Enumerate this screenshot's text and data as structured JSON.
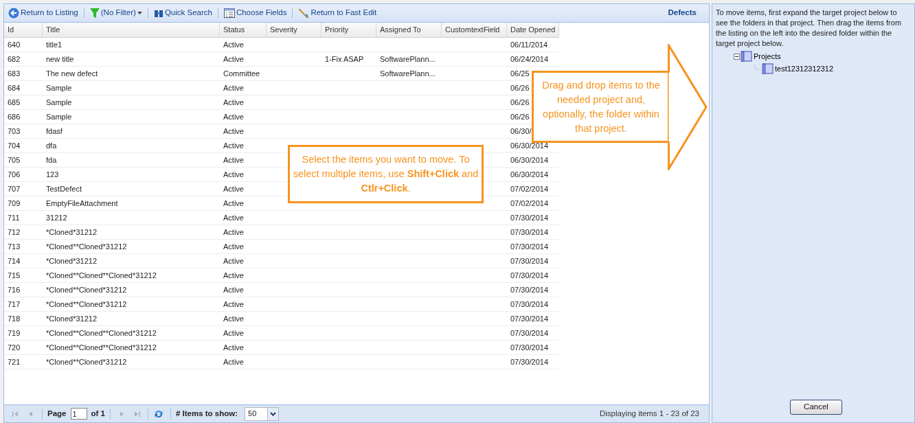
{
  "toolbar": {
    "buttons": [
      {
        "kind": "back",
        "label": "Return to Listing"
      },
      {
        "kind": "filter",
        "label": "(No Filter)"
      },
      {
        "kind": "search",
        "label": "Quick Search"
      },
      {
        "kind": "fields",
        "label": "Choose Fields"
      },
      {
        "kind": "edit",
        "label": "Return to Fast Edit"
      }
    ],
    "title": "Defects"
  },
  "table": {
    "columns": [
      "Id",
      "Title",
      "Status",
      "Severity",
      "Priority",
      "Assigned To",
      "CustomtextField",
      "Date Opened"
    ],
    "rows": [
      {
        "id": "640",
        "title": "title1",
        "status": "Active",
        "date_opened": "06/11/2014"
      },
      {
        "id": "682",
        "title": "new title",
        "status": "Active",
        "priority": "1-Fix ASAP",
        "assigned_to": "SoftwarePlann...",
        "date_opened": "06/24/2014"
      },
      {
        "id": "683",
        "title": "The new defect",
        "status": "Committee",
        "assigned_to": "SoftwarePlann...",
        "date_opened": "06/25"
      },
      {
        "id": "684",
        "title": "Sample",
        "status": "Active",
        "date_opened": "06/26"
      },
      {
        "id": "685",
        "title": "Sample",
        "status": "Active",
        "date_opened": "06/26"
      },
      {
        "id": "686",
        "title": "Sample",
        "status": "Active",
        "date_opened": "06/26"
      },
      {
        "id": "703",
        "title": "fdasf",
        "status": "Active",
        "date_opened": "06/30/"
      },
      {
        "id": "704",
        "title": "dfa",
        "status": "Active",
        "date_opened": "06/30/2014"
      },
      {
        "id": "705",
        "title": "fda",
        "status": "Active",
        "date_opened": "06/30/2014"
      },
      {
        "id": "706",
        "title": "123",
        "status": "Active",
        "date_opened": "06/30/2014"
      },
      {
        "id": "707",
        "title": "TestDefect",
        "status": "Active",
        "date_opened": "07/02/2014"
      },
      {
        "id": "709",
        "title": "EmptyFileAttachment",
        "status": "Active",
        "date_opened": "07/02/2014"
      },
      {
        "id": "711",
        "title": "31212",
        "status": "Active",
        "date_opened": "07/30/2014"
      },
      {
        "id": "712",
        "title": "*Cloned*31212",
        "status": "Active",
        "date_opened": "07/30/2014"
      },
      {
        "id": "713",
        "title": "*Cloned**Cloned*31212",
        "status": "Active",
        "date_opened": "07/30/2014"
      },
      {
        "id": "714",
        "title": "*Cloned*31212",
        "status": "Active",
        "date_opened": "07/30/2014"
      },
      {
        "id": "715",
        "title": "*Cloned**Cloned**Cloned*31212",
        "status": "Active",
        "date_opened": "07/30/2014"
      },
      {
        "id": "716",
        "title": "*Cloned**Cloned*31212",
        "status": "Active",
        "date_opened": "07/30/2014"
      },
      {
        "id": "717",
        "title": "*Cloned**Cloned*31212",
        "status": "Active",
        "date_opened": "07/30/2014"
      },
      {
        "id": "718",
        "title": "*Cloned*31212",
        "status": "Active",
        "date_opened": "07/30/2014"
      },
      {
        "id": "719",
        "title": "*Cloned**Cloned**Cloned*31212",
        "status": "Active",
        "date_opened": "07/30/2014"
      },
      {
        "id": "720",
        "title": "*Cloned**Cloned**Cloned*31212",
        "status": "Active",
        "date_opened": "07/30/2014"
      },
      {
        "id": "721",
        "title": "*Cloned**Cloned*31212",
        "status": "Active",
        "date_opened": "07/30/2014"
      }
    ]
  },
  "pager": {
    "nav": [
      {
        "kind": "first",
        "disabled": true
      },
      {
        "kind": "prev",
        "disabled": true
      }
    ],
    "page_label": "Page",
    "page": "1",
    "of": "of 1",
    "nav_after": [
      {
        "kind": "next",
        "disabled": true
      },
      {
        "kind": "last",
        "disabled": true
      }
    ],
    "items_label": "# Items to show:",
    "items_value": "50",
    "summary": "Displaying items 1 - 23 of 23"
  },
  "callouts": [
    {
      "kind": "box",
      "text": "Select the items you want to move. To select multiple items, use **Shift+Click** and **Ctlr+Click**."
    },
    {
      "kind": "arrow",
      "text": "Drag and drop items to the needed project and, optionally, the folder within that project."
    }
  ],
  "side_panel": {
    "instructions": "To move items, first expand the target project below to see the folders in that project. Then drag the items from the listing on the left into the desired folder within the target project below.",
    "tree": [
      {
        "label": "Projects",
        "expanded": true,
        "children": [
          {
            "label": "test12312312312"
          }
        ]
      }
    ],
    "button": "Cancel"
  }
}
